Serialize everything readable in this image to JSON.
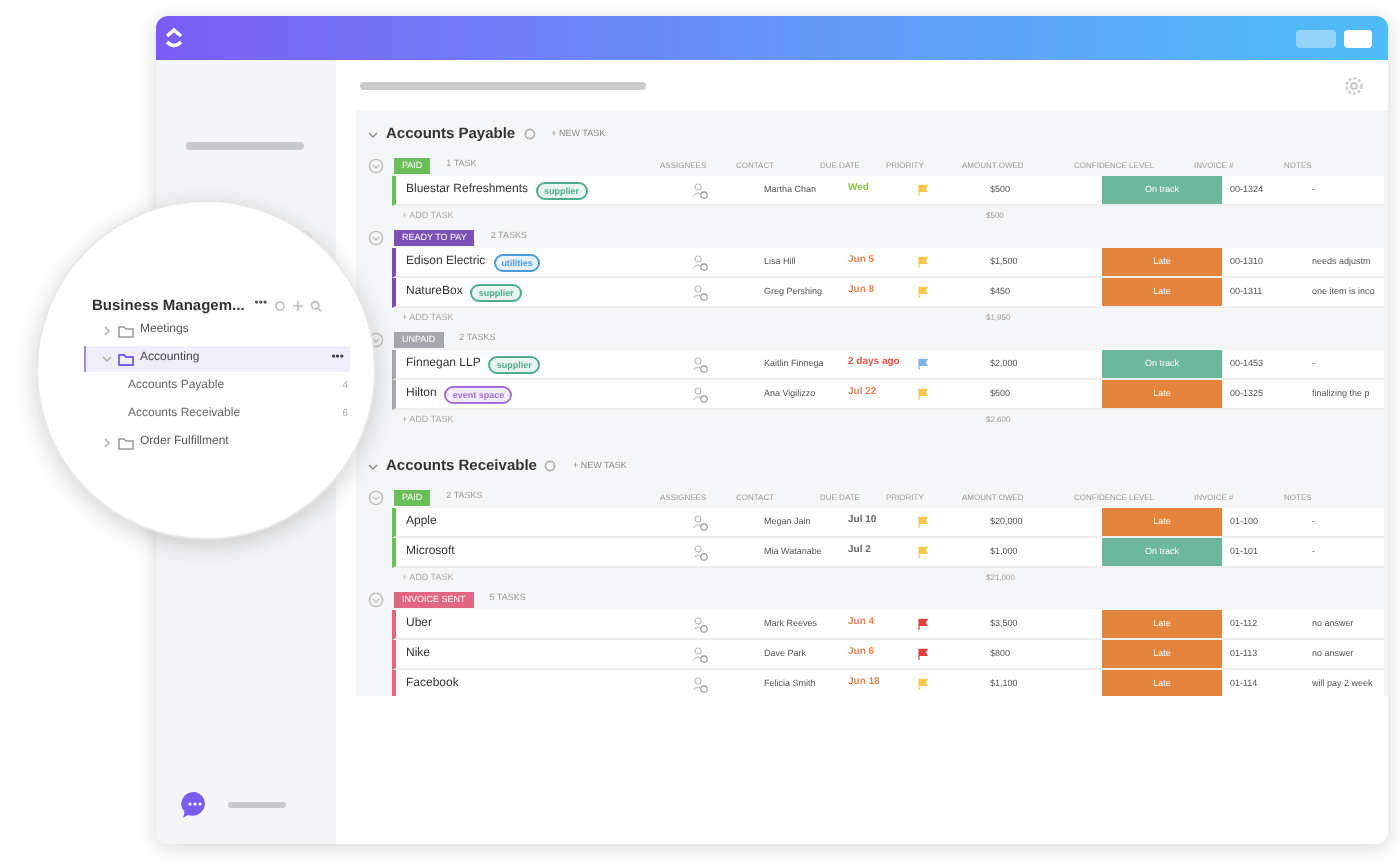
{
  "workspace": {
    "title": "Business Managem...",
    "more": "•••"
  },
  "tree": [
    {
      "label": "Meetings",
      "selected": false,
      "expanded": false
    },
    {
      "label": "Accounting",
      "selected": true,
      "expanded": true,
      "more": "•••",
      "children": [
        {
          "label": "Accounts Payable",
          "count": "4"
        },
        {
          "label": "Accounts Receivable",
          "count": "6"
        }
      ]
    },
    {
      "label": "Order Fulfillment",
      "selected": false,
      "expanded": false
    }
  ],
  "sections": [
    {
      "title": "Accounts Payable",
      "new_task": "+ NEW TASK",
      "columns": [
        "ASSIGNEES",
        "CONTACT",
        "DUE DATE",
        "PRIORITY",
        "AMOUNT OWED",
        "CONFIDENCE LEVEL",
        "INVOICE #",
        "NOTES"
      ],
      "groups": [
        {
          "status": "PAID",
          "color": "#6bbf59",
          "count": "1 TASK",
          "add_task": "+ ADD TASK",
          "total": "$500",
          "rows": [
            {
              "name": "Bluestar Refreshments",
              "tag": {
                "label": "supplier",
                "color": "#4fae88"
              },
              "contact": "Martha Chan",
              "due": {
                "text": "Wed",
                "color": "#8bc34a"
              },
              "priority": {
                "color": "#f5c84c"
              },
              "amount": "$500",
              "confidence": {
                "kind": "on_track",
                "label": "On track"
              },
              "invoice": "00-1324",
              "notes": "-"
            }
          ]
        },
        {
          "status": "READY TO PAY",
          "color": "#7b4fb4",
          "count": "2 TASKS",
          "add_task": "+ ADD TASK",
          "total": "$1,950",
          "rows": [
            {
              "name": "Edison Electric",
              "tag": {
                "label": "utilities",
                "color": "#4c9bd9"
              },
              "contact": "Lisa Hill",
              "due": {
                "text": "Jun 5",
                "color": "#ef8354"
              },
              "priority": {
                "color": "#f5c84c"
              },
              "amount": "$1,500",
              "confidence": {
                "kind": "late",
                "label": "Late"
              },
              "invoice": "00-1310",
              "notes": "needs adjustm"
            },
            {
              "name": "NatureBox",
              "tag": {
                "label": "supplier",
                "color": "#4fae88"
              },
              "contact": "Greg Pershing",
              "due": {
                "text": "Jun 8",
                "color": "#ef8354"
              },
              "priority": {
                "color": "#f5c84c"
              },
              "amount": "$450",
              "confidence": {
                "kind": "late",
                "label": "Late"
              },
              "invoice": "00-1311",
              "notes": "one item is inco"
            }
          ]
        },
        {
          "status": "UNPAID",
          "color": "#a5a7ab",
          "count": "2 TASKS",
          "add_task": "+ ADD TASK",
          "total": "$2,600",
          "rows": [
            {
              "name": "Finnegan LLP",
              "tag": {
                "label": "supplier",
                "color": "#4fae88"
              },
              "contact": "Kaitlin Finnega",
              "due": {
                "text": "2 days ago",
                "color": "#e5534b"
              },
              "priority": {
                "color": "#7fb6e8"
              },
              "amount": "$2,000",
              "confidence": {
                "kind": "on_track",
                "label": "On track"
              },
              "invoice": "00-1453",
              "notes": "-"
            },
            {
              "name": "Hilton",
              "tag": {
                "label": "event space",
                "color": "#a070d6"
              },
              "contact": "Ana Vigilizzo",
              "due": {
                "text": "Jul 22",
                "color": "#ef8354"
              },
              "priority": {
                "color": "#f5c84c"
              },
              "amount": "$600",
              "confidence": {
                "kind": "late",
                "label": "Late"
              },
              "invoice": "00-1325",
              "notes": "finalizing the p"
            }
          ]
        }
      ]
    },
    {
      "title": "Accounts Receivable",
      "new_task": "+ NEW TASK",
      "columns": [
        "ASSIGNEES",
        "CONTACT",
        "DUE DATE",
        "PRIORITY",
        "AMOUNT OWED",
        "CONFIDENCE LEVEL",
        "INVOICE #",
        "NOTES"
      ],
      "groups": [
        {
          "status": "PAID",
          "color": "#6bbf59",
          "count": "2 TASKS",
          "add_task": "+ ADD TASK",
          "total": "$21,000",
          "rows": [
            {
              "name": "Apple",
              "contact": "Megan Jain",
              "due": {
                "text": "Jul 10",
                "color": "#666666"
              },
              "priority": {
                "color": "#f5c84c"
              },
              "amount": "$20,000",
              "confidence": {
                "kind": "late",
                "label": "Late"
              },
              "invoice": "01-100",
              "notes": "-"
            },
            {
              "name": "Microsoft",
              "contact": "Mia Watanabe",
              "due": {
                "text": "Jul 2",
                "color": "#666666"
              },
              "priority": {
                "color": "#f5c84c"
              },
              "amount": "$1,000",
              "confidence": {
                "kind": "on_track",
                "label": "On track"
              },
              "invoice": "01-101",
              "notes": "-"
            }
          ]
        },
        {
          "status": "INVOICE SENT",
          "color": "#e06681",
          "count": "5 TASKS",
          "rows": [
            {
              "name": "Uber",
              "contact": "Mark Reeves",
              "due": {
                "text": "Jun 4",
                "color": "#ef8354"
              },
              "priority": {
                "color": "#e04040"
              },
              "amount": "$3,500",
              "confidence": {
                "kind": "late",
                "label": "Late"
              },
              "invoice": "01-112",
              "notes": "no answer"
            },
            {
              "name": "Nike",
              "contact": "Dave Park",
              "due": {
                "text": "Jun 6",
                "color": "#ef8354"
              },
              "priority": {
                "color": "#e04040"
              },
              "amount": "$800",
              "confidence": {
                "kind": "late",
                "label": "Late"
              },
              "invoice": "01-113",
              "notes": "no answer"
            },
            {
              "name": "Facebook",
              "contact": "Felicia Smith",
              "due": {
                "text": "Jun 18",
                "color": "#ef8354"
              },
              "priority": {
                "color": "#f5c84c"
              },
              "amount": "$1,100",
              "confidence": {
                "kind": "late",
                "label": "Late"
              },
              "invoice": "01-114",
              "notes": "will pay 2 week"
            }
          ]
        }
      ]
    }
  ]
}
